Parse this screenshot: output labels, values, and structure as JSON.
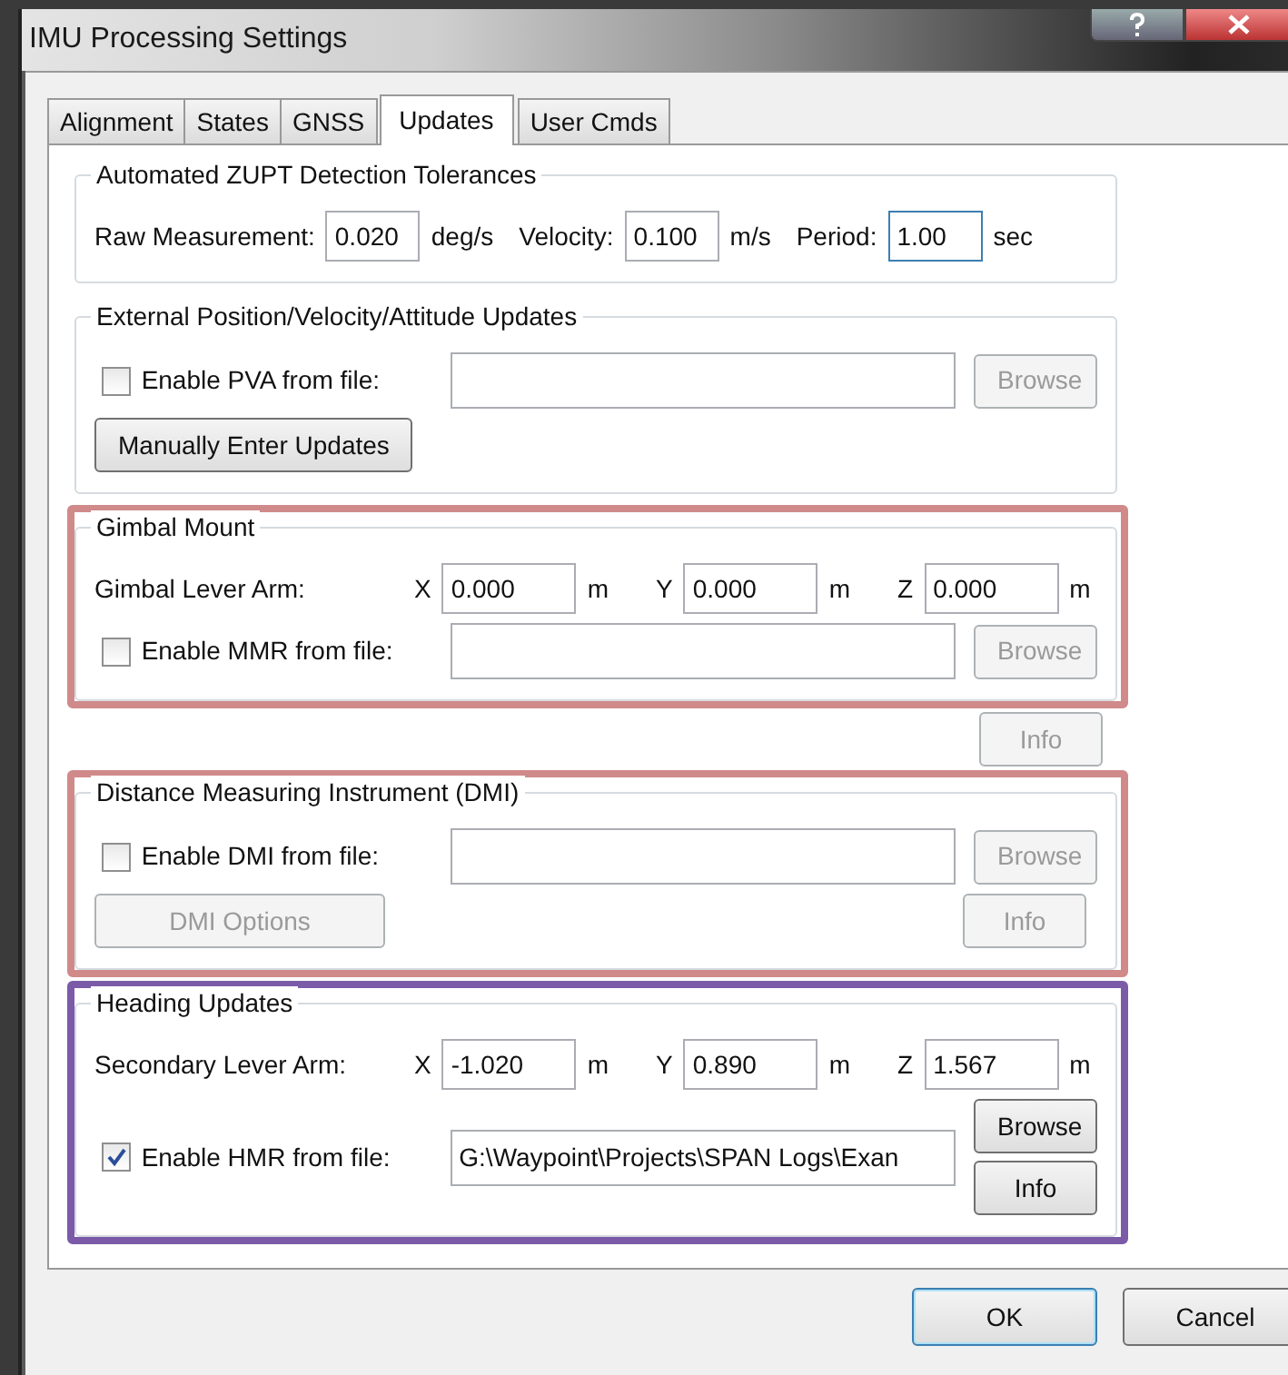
{
  "window": {
    "title": "IMU Processing Settings"
  },
  "tabs": [
    {
      "label": "Alignment",
      "selected": false
    },
    {
      "label": "States",
      "selected": false
    },
    {
      "label": "GNSS",
      "selected": false
    },
    {
      "label": "Updates",
      "selected": true
    },
    {
      "label": "User Cmds",
      "selected": false
    }
  ],
  "sections": [
    {
      "kind": "group",
      "title": "Automated ZUPT Detection Tolerances",
      "rows": [
        {
          "kind": "tolerances",
          "items": [
            {
              "label": "Raw Measurement:",
              "value": "0.020",
              "unit": "deg/s",
              "focused": false
            },
            {
              "label": "Velocity:",
              "value": "0.100",
              "unit": "m/s",
              "focused": false
            },
            {
              "label": "Period:",
              "value": "1.00",
              "unit": "sec",
              "focused": true
            }
          ]
        }
      ]
    },
    {
      "kind": "group",
      "title": "External Position/Velocity/Attitude Updates",
      "rows": [
        {
          "kind": "file",
          "label": "Enable PVA from file:",
          "checked": false,
          "buttons": [
            {
              "label": "Browse",
              "disabled": true
            }
          ]
        },
        {
          "kind": "buttons",
          "buttons": [
            {
              "label": "Manually Enter Updates",
              "disabled": false
            }
          ]
        }
      ]
    },
    {
      "kind": "group",
      "title": "Gimbal Mount",
      "color": "#d08a8a",
      "rows": [
        {
          "kind": "lever",
          "label": "Gimbal Lever Arm:",
          "axes": [
            {
              "axis": "X",
              "value": "0.000",
              "unit": "m"
            },
            {
              "axis": "Y",
              "value": "0.000",
              "unit": "m"
            },
            {
              "axis": "Z",
              "value": "0.000",
              "unit": "m"
            }
          ]
        },
        {
          "kind": "file",
          "label": "Enable MMR from file:",
          "checked": false,
          "buttons": [
            {
              "label": "Browse",
              "disabled": true
            }
          ]
        }
      ]
    },
    {
      "kind": "button_row",
      "buttons": [
        {
          "label": "Info",
          "disabled": true
        }
      ]
    },
    {
      "kind": "group",
      "title": "Distance Measuring Instrument (DMI)",
      "color": "#d08a8a",
      "rows": [
        {
          "kind": "file",
          "label": "Enable DMI from file:",
          "checked": false,
          "buttons": [
            {
              "label": "Browse",
              "disabled": true
            }
          ]
        },
        {
          "kind": "split",
          "left": {
            "label": "DMI Options",
            "disabled": true
          },
          "right": {
            "label": "Info",
            "disabled": true
          }
        }
      ]
    },
    {
      "kind": "group",
      "title": "Heading Updates",
      "color": "#7b5ba8",
      "rows": [
        {
          "kind": "lever",
          "label": "Secondary Lever Arm:",
          "axes": [
            {
              "axis": "X",
              "value": "-1.020",
              "unit": "m"
            },
            {
              "axis": "Y",
              "value": "0.890",
              "unit": "m"
            },
            {
              "axis": "Z",
              "value": "1.567",
              "unit": "m"
            }
          ]
        },
        {
          "kind": "file",
          "label": "Enable HMR from file:",
          "checked": true,
          "value": "G:\\Waypoint\\Projects\\SPAN Logs\\Exan",
          "buttons": [
            {
              "label": "Browse",
              "disabled": false
            },
            {
              "label": "Info",
              "disabled": false
            }
          ]
        }
      ]
    }
  ],
  "footer": [
    {
      "label": "OK",
      "default": true
    },
    {
      "label": "Cancel",
      "default": false
    }
  ]
}
